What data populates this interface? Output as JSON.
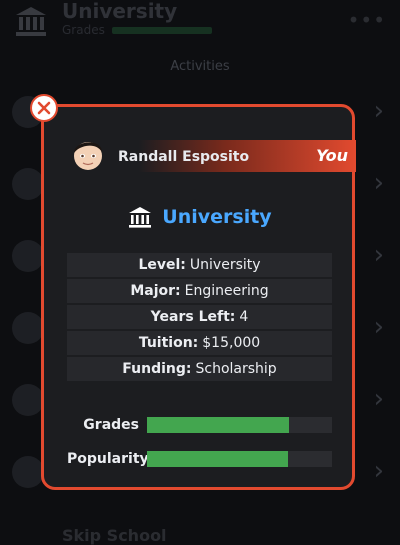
{
  "background": {
    "title": "University",
    "subtitle": "Grades",
    "grades_bar_fraction": 0.75,
    "section_label": "Activities",
    "menu_dots": "•••",
    "footer_label": "Skip School"
  },
  "modal": {
    "player_name": "Randall Esposito",
    "you_label": "You",
    "title": "University",
    "details": [
      {
        "key": "Level:",
        "value": "University"
      },
      {
        "key": "Major:",
        "value": "Engineering"
      },
      {
        "key": "Years Left:",
        "value": "4"
      },
      {
        "key": "Tuition:",
        "value": "$15,000"
      },
      {
        "key": "Funding:",
        "value": "Scholarship"
      }
    ],
    "stats": [
      {
        "label": "Grades",
        "fraction": 0.77
      },
      {
        "label": "Popularity",
        "fraction": 0.76
      }
    ],
    "colors": {
      "accent": "#e24a2f",
      "title_blue": "#4aa8ff",
      "bar_green": "#43a64f"
    },
    "icons": {
      "close": "close-icon",
      "building": "university-building-icon",
      "avatar": "avatar"
    }
  }
}
